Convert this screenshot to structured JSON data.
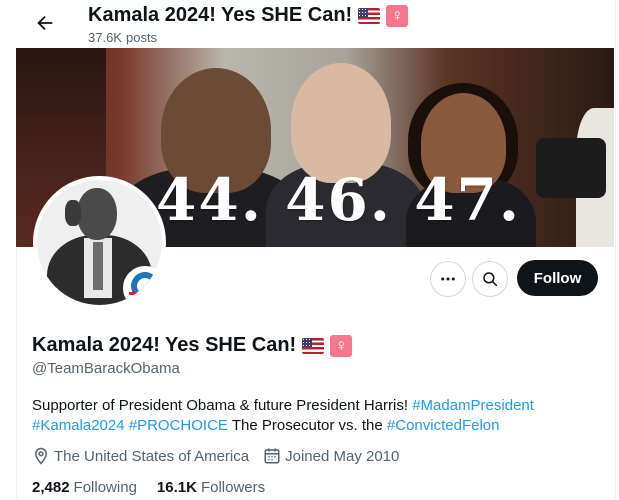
{
  "header": {
    "title": "Kamala 2024! Yes SHE Can!",
    "posts_count": "37.6K",
    "posts_label": "posts"
  },
  "banner": {
    "overlay_text": "44. 46. 47."
  },
  "actions": {
    "follow_label": "Follow"
  },
  "profile": {
    "display_name": "Kamala 2024! Yes SHE Can!",
    "handle": "@TeamBarackObama",
    "bio_text_1": "Supporter of President Obama & future President Harris! ",
    "bio_tag_1": "#MadamPresident",
    "bio_tag_2": "#Kamala2024",
    "bio_tag_3": "#PROCHOICE",
    "bio_text_2": " The Prosecutor vs. the ",
    "bio_tag_4": "#ConvictedFelon",
    "location": "The United States of America",
    "joined": "Joined May 2010"
  },
  "stats": {
    "following_count": "2,482",
    "following_label": "Following",
    "followers_count": "16.1K",
    "followers_label": "Followers"
  },
  "emoji": {
    "female_sign": "♀"
  },
  "colors": {
    "link": "#1d9bf0",
    "follow_bg": "#0f1419",
    "secondary_text": "#536471"
  }
}
